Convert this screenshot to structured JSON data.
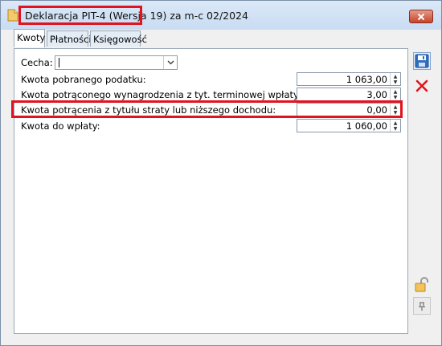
{
  "window": {
    "title_highlighted": "Deklaracja PIT-4 (Wersja 19)",
    "title_rest": " za m-c 02/2024"
  },
  "tabs": [
    {
      "label": "Kwoty"
    },
    {
      "label": "Płatności"
    },
    {
      "label": "Księgowość"
    }
  ],
  "form": {
    "cecha_label": "Cecha:",
    "cecha_value": "",
    "rows": [
      {
        "label": "Kwota pobranego podatku:",
        "value": "1 063,00"
      },
      {
        "label": "Kwota potrąconego wynagrodzenia z tyt. terminowej wpłaty podatku:",
        "value": "3,00"
      },
      {
        "label": "Kwota potrącenia z tytułu straty lub niższego dochodu:",
        "value": "0,00"
      },
      {
        "label": "Kwota do wpłaty:",
        "value": "1 060,00"
      }
    ]
  },
  "colors": {
    "highlight": "#e0141e",
    "accent": "#2f6fc0"
  },
  "icons": [
    "document-icon",
    "close-icon",
    "save-icon",
    "delete-icon",
    "lock-icon",
    "pin-icon",
    "chevron-down-icon",
    "spin-arrows-icon"
  ]
}
